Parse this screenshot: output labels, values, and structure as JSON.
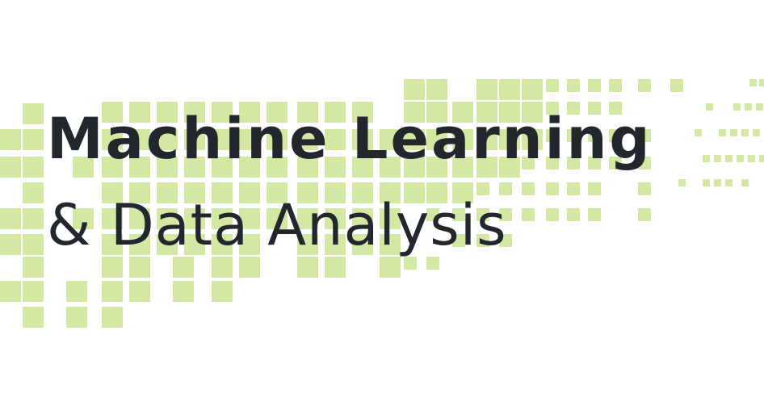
{
  "title": {
    "line1": "Machine Learning",
    "line2": "& Data Analysis"
  },
  "colors": {
    "background": "#ffffff",
    "pattern": "#d3e8a3",
    "text": "#22272e"
  },
  "decoration": {
    "pattern_icon": "pixel-grid-icon"
  }
}
